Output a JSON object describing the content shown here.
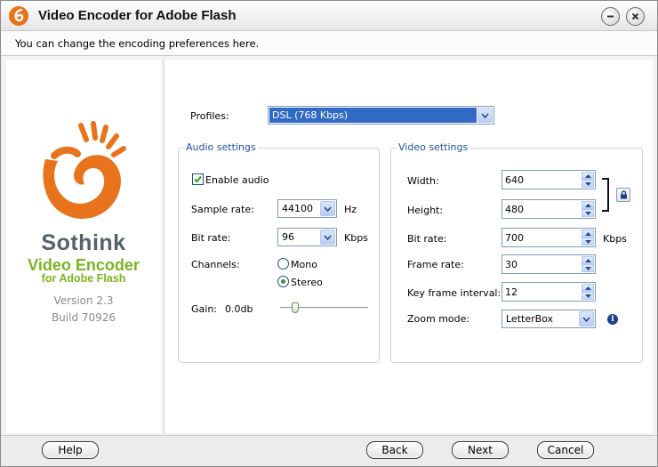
{
  "window": {
    "title": "Video Encoder for Adobe Flash",
    "info_text": "You can change the encoding preferences here."
  },
  "sidebar": {
    "brand_line1": "Sothink",
    "brand_line2": "Video Encoder",
    "brand_line3": "for Adobe Flash",
    "version": "Version 2.3",
    "build": "Build 70926"
  },
  "profiles": {
    "label": "Profiles:",
    "value": "DSL (768 Kbps)"
  },
  "audio": {
    "title": "Audio settings",
    "enable_label": "Enable audio",
    "enabled": true,
    "sample_rate_label": "Sample rate:",
    "sample_rate_value": "44100",
    "sample_rate_unit": "Hz",
    "bit_rate_label": "Bit rate:",
    "bit_rate_value": "96",
    "bit_rate_unit": "Kbps",
    "channels_label": "Channels:",
    "mono_label": "Mono",
    "stereo_label": "Stereo",
    "selected_channel": "Stereo",
    "gain_label": "Gain:",
    "gain_value": "0.0db",
    "gain_slider_fraction": 0.17
  },
  "video": {
    "title": "Video settings",
    "width_label": "Width:",
    "width_value": "640",
    "height_label": "Height:",
    "height_value": "480",
    "bit_rate_label": "Bit rate:",
    "bit_rate_value": "700",
    "bit_rate_unit": "Kbps",
    "frame_rate_label": "Frame rate:",
    "frame_rate_value": "30",
    "key_frame_label": "Key frame interval:",
    "key_frame_value": "12",
    "zoom_mode_label": "Zoom mode:",
    "zoom_mode_value": "LetterBox"
  },
  "footer": {
    "help": "Help",
    "back": "Back",
    "next": "Next",
    "cancel": "Cancel"
  },
  "icons": {
    "app": "sothink-logo-icon",
    "minimize": "minimize-icon",
    "close": "close-icon",
    "lock": "lock-icon",
    "info": "info-icon",
    "dropdown": "chevron-down-icon"
  },
  "colors": {
    "accent_blue": "#316ac5",
    "brand_orange": "#e8731c",
    "brand_green": "#7bb421",
    "brand_gray": "#56616b",
    "group_title": "#1f4fa8"
  }
}
